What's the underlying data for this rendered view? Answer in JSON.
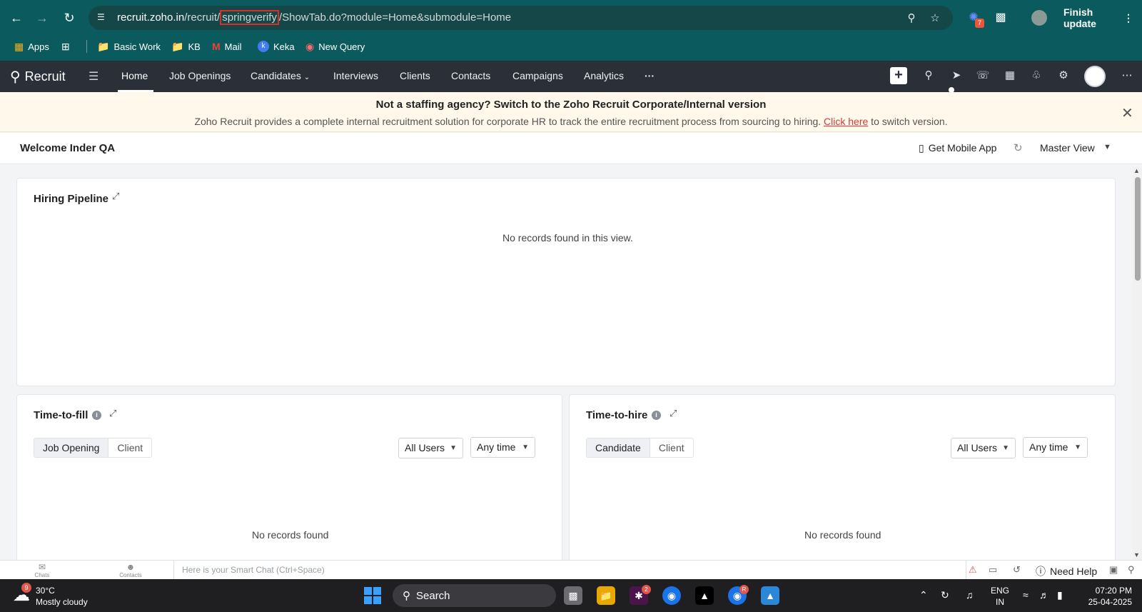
{
  "browser": {
    "url_host": "recruit.zoho.in",
    "url_pre": "/recruit/",
    "url_highlight": "springverify",
    "url_post": "/ShowTab.do?module=Home&submodule=Home",
    "extension_badge": "7",
    "finish_update_label": "Finish update",
    "bookmarks": [
      "Apps",
      "Basic Work",
      "KB",
      "Mail",
      "Keka",
      "New Query"
    ]
  },
  "app": {
    "name": "Recruit",
    "tabs": [
      "Home",
      "Job Openings",
      "Candidates",
      "Interviews",
      "Clients",
      "Contacts",
      "Campaigns",
      "Analytics"
    ],
    "more": "···"
  },
  "banner": {
    "title": "Not a staffing agency? Switch to the Zoho Recruit Corporate/Internal version",
    "text_before": "Zoho Recruit provides a complete internal recruitment solution for corporate HR to track the entire recruitment process from sourcing to hiring. ",
    "link": "Click here",
    "text_after": " to switch version."
  },
  "welcome": {
    "text": "Welcome Inder QA",
    "mobile_app": "Get Mobile App",
    "view": "Master View"
  },
  "hiring_pipeline": {
    "title": "Hiring Pipeline",
    "empty": "No records found in this view."
  },
  "time_to_fill": {
    "title": "Time-to-fill",
    "seg": [
      "Job Opening",
      "Client"
    ],
    "users": "All Users",
    "time": "Any time",
    "empty": "No records found"
  },
  "time_to_hire": {
    "title": "Time-to-hire",
    "seg": [
      "Candidate",
      "Client"
    ],
    "users": "All Users",
    "time": "Any time",
    "empty": "No records found"
  },
  "chat_bar": {
    "chats": "Chats",
    "contacts": "Contacts",
    "placeholder": "Here is your Smart Chat (Ctrl+Space)",
    "need_help": "Need Help"
  },
  "taskbar": {
    "temp": "30°C",
    "weather": "Mostly cloudy",
    "weather_badge": "9",
    "search": "Search",
    "slack_badge": "2",
    "chrome_badge": "R",
    "lang1": "ENG",
    "lang2": "IN",
    "time": "07:20 PM",
    "date": "25-04-2025"
  }
}
